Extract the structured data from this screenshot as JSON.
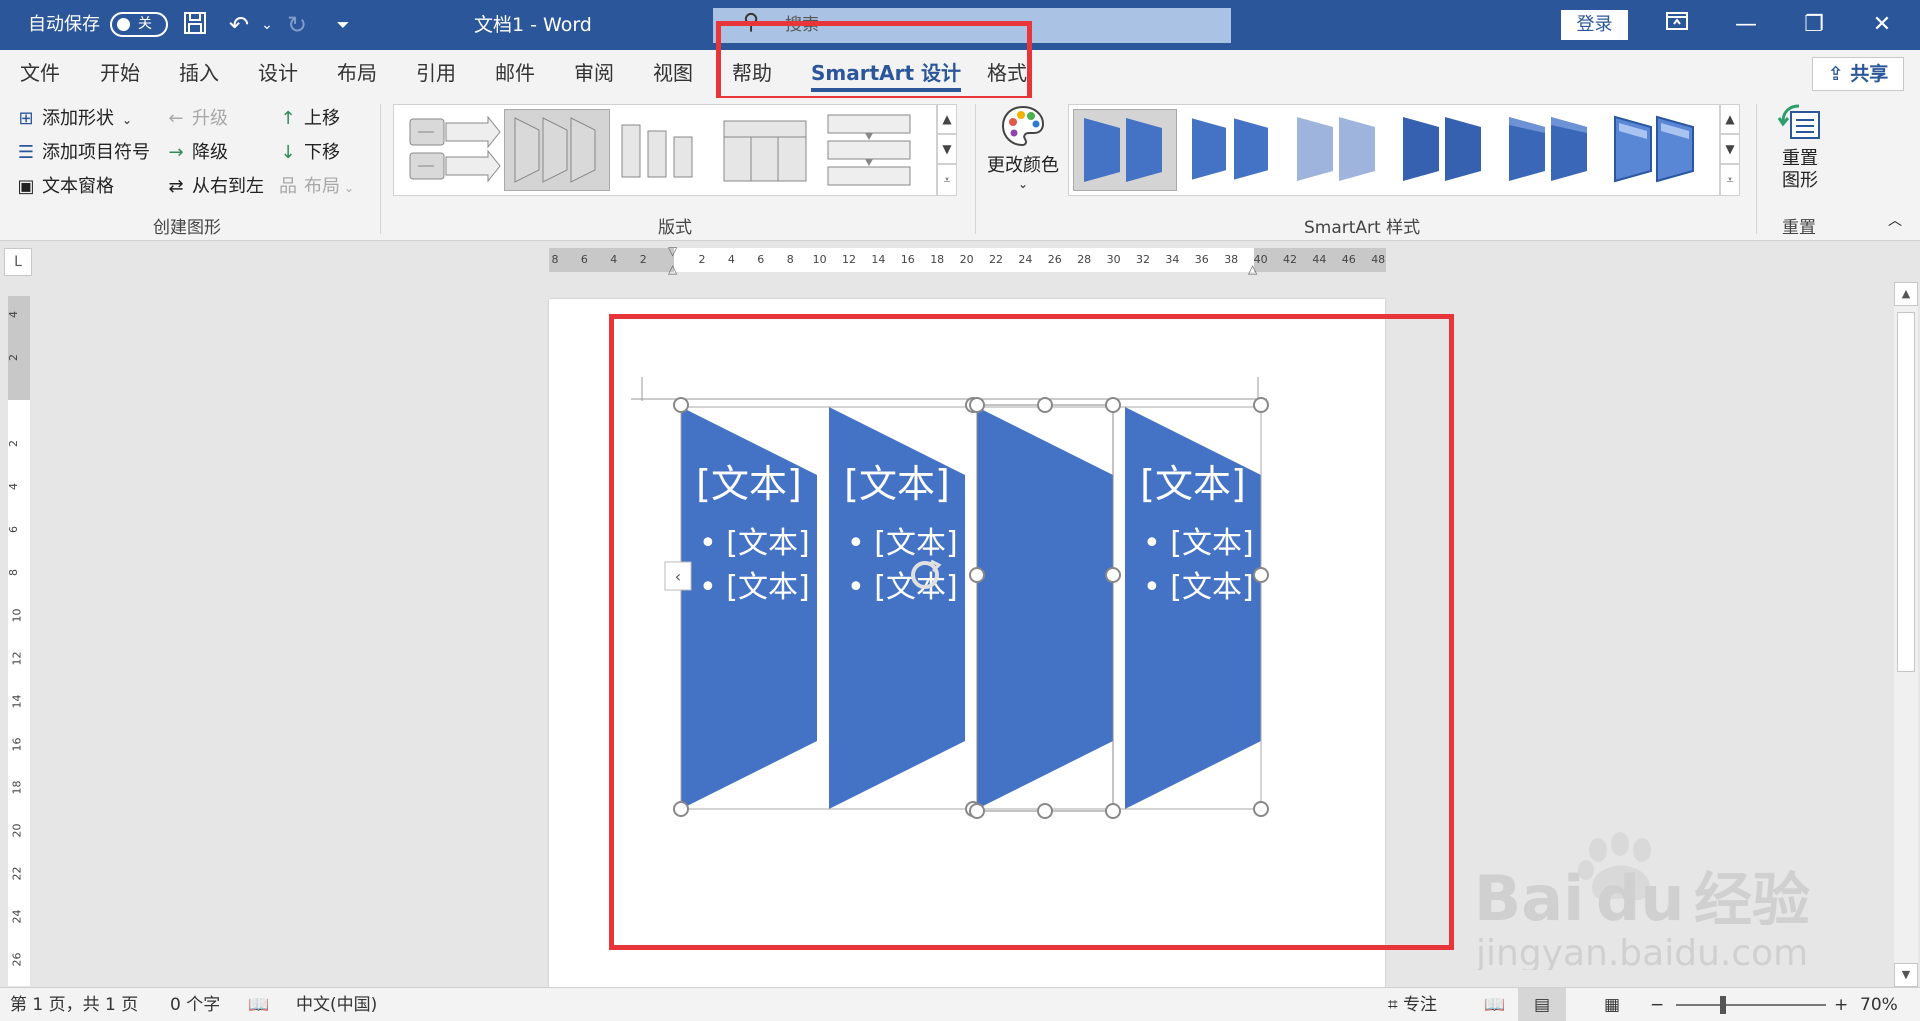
{
  "titlebar": {
    "autosave_label": "自动保存",
    "autosave_state": "关",
    "doc_title": "文档1 - Word",
    "search_placeholder": "搜索",
    "login_label": "登录",
    "colors": {
      "title_bg": "#2b579a",
      "search_bg": "#aac3e4"
    }
  },
  "menu": {
    "tabs": [
      "文件",
      "开始",
      "插入",
      "设计",
      "布局",
      "引用",
      "邮件",
      "审阅",
      "视图",
      "帮助",
      "SmartArt 设计",
      "格式"
    ],
    "active_tab": "SmartArt 设计",
    "share_label": "共享"
  },
  "ribbon": {
    "create_graphic": {
      "add_shape": "添加形状",
      "add_bullet": "添加项目符号",
      "text_pane": "文本窗格",
      "promote": "升级",
      "demote": "降级",
      "right_to_left": "从右到左",
      "move_up": "上移",
      "move_down": "下移",
      "layout": "布局",
      "group_label": "创建图形"
    },
    "layouts": {
      "group_label": "版式",
      "selected_index": 1
    },
    "change_colors_label": "更改颜色",
    "styles": {
      "group_label": "SmartArt 样式",
      "selected_index": 0
    },
    "reset": {
      "button_label": "重置图形",
      "group_label": "重置"
    }
  },
  "ruler": {
    "h_ticks": [
      "8",
      "6",
      "4",
      "2",
      "",
      "2",
      "4",
      "6",
      "8",
      "10",
      "12",
      "14",
      "16",
      "18",
      "20",
      "22",
      "24",
      "26",
      "28",
      "30",
      "32",
      "34",
      "36",
      "38",
      "40",
      "42",
      "44",
      "46",
      "48"
    ],
    "v_ticks": [
      "4",
      "2",
      "",
      "2",
      "4",
      "6",
      "8",
      "10",
      "12",
      "14",
      "16",
      "18",
      "20",
      "22",
      "24",
      "26"
    ]
  },
  "smartart": {
    "shape_fill": "#4472c4",
    "shapes": [
      {
        "title": "[文本]",
        "bullets": [
          "[文本]",
          "[文本]"
        ]
      },
      {
        "title": "[文本]",
        "bullets": [
          "[文本]",
          "[文本]"
        ]
      },
      {
        "title": "",
        "bullets": []
      },
      {
        "title": "[文本]",
        "bullets": [
          "[文本]",
          "[文本]"
        ]
      }
    ]
  },
  "status": {
    "page": "第 1 页，共 1 页",
    "words": "0 个字",
    "language": "中文(中国)",
    "focus": "专注",
    "zoom": "70%"
  },
  "watermark": {
    "brand_a": "Bai",
    "brand_b": "du",
    "brand_c": "经验",
    "url": "jingyan.baidu.com"
  },
  "annotation_color": "#e8353a"
}
